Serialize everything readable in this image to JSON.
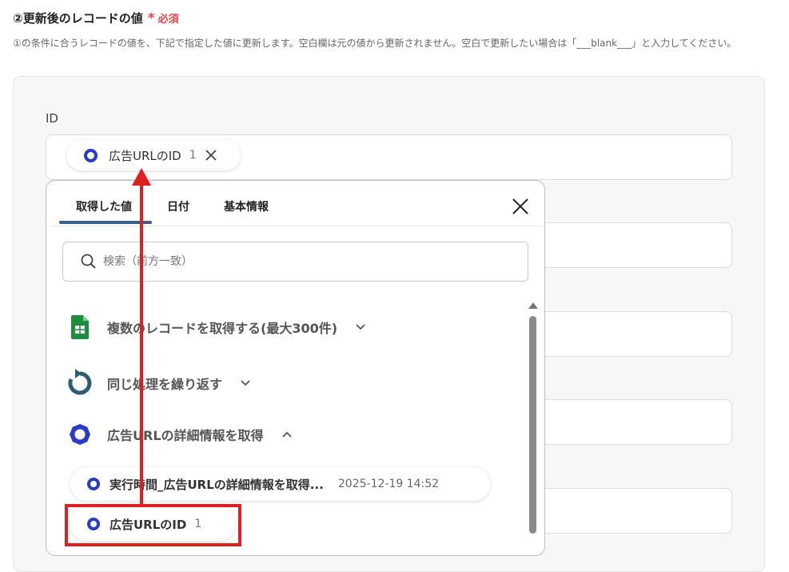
{
  "section": {
    "title": "②更新後のレコードの値",
    "required_star": "*",
    "required_label": "必須",
    "description": "①の条件に合うレコードの値を、下記で指定した値に更新します。空白欄は元の値から更新されません。空白で更新したい場合は「___blank___」と入力してください。"
  },
  "field": {
    "label": "ID",
    "chip": {
      "text": "広告URLのID",
      "count": "1",
      "remove_icon": "close-icon"
    }
  },
  "popover": {
    "tabs": [
      {
        "label": "取得した値",
        "active": true
      },
      {
        "label": "日付",
        "active": false
      },
      {
        "label": "基本情報",
        "active": false
      }
    ],
    "search": {
      "placeholder": "検索（前方一致）",
      "value": ""
    },
    "tree": [
      {
        "label": "複数のレコードを取得する(最大300件)",
        "icon": "google-sheets-icon",
        "expanded": false
      },
      {
        "label": "同じ処理を繰り返す",
        "icon": "loop-icon",
        "expanded": false
      },
      {
        "label": "広告URLの詳細情報を取得",
        "icon": "ring-icon",
        "expanded": true
      }
    ],
    "values": [
      {
        "label": "実行時間_広告URLの詳細情報を取得...",
        "meta": "2025-12-19 14:52"
      },
      {
        "label": "広告URLのID",
        "meta": "1"
      }
    ]
  },
  "colors": {
    "accent": "#2a3bc9",
    "required": "#e5484d",
    "annotation": "#e02020",
    "tab_underline": "#3a5f8c",
    "sheets_green": "#1e8e3e",
    "loop_teal": "#2c5d73"
  }
}
